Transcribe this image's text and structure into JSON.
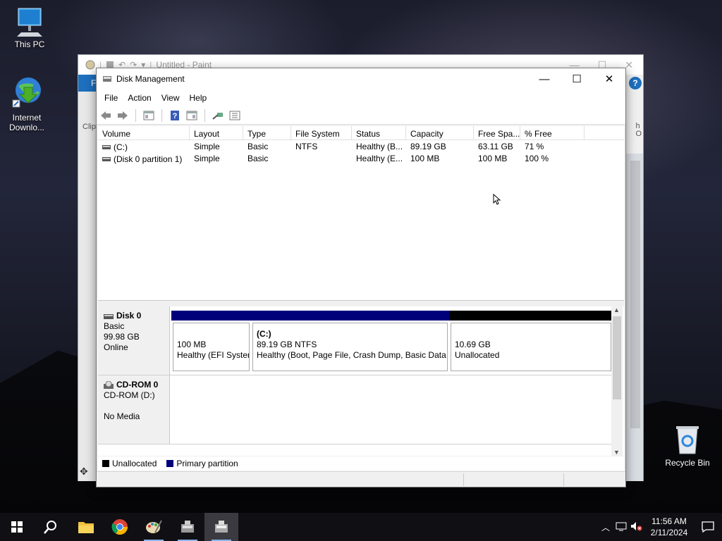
{
  "desktop": {
    "icons": [
      {
        "label": "This PC"
      },
      {
        "label": "Internet Downlo..."
      },
      {
        "label": "Recycle Bin"
      }
    ]
  },
  "paint": {
    "title": "Untitled - Paint",
    "ribbon_tab": "F",
    "clip_fragment": "Clip",
    "right_fragment": "h\nO"
  },
  "window": {
    "title": "Disk Management",
    "minimize": "—",
    "maximize": "☐",
    "close": "✕"
  },
  "menu": [
    "File",
    "Action",
    "View",
    "Help"
  ],
  "toolbar_icons": [
    "back-arrow-icon",
    "forward-arrow-icon",
    "properties-icon",
    "help-icon",
    "console-icon",
    "rescan-icon",
    "list-icon"
  ],
  "volumes": {
    "columns": [
      "Volume",
      "Layout",
      "Type",
      "File System",
      "Status",
      "Capacity",
      "Free Spa...",
      "% Free"
    ],
    "rows": [
      [
        "(C:)",
        "Simple",
        "Basic",
        "NTFS",
        "Healthy (B...",
        "89.19 GB",
        "63.11 GB",
        "71 %"
      ],
      [
        "(Disk 0 partition 1)",
        "Simple",
        "Basic",
        "",
        "Healthy (E...",
        "100 MB",
        "100 MB",
        "100 %"
      ]
    ]
  },
  "disks": [
    {
      "name": "Disk 0",
      "type": "Basic",
      "size": "99.98 GB",
      "state": "Online",
      "partitions": [
        {
          "label": "",
          "size": "100 MB",
          "status": "Healthy (EFI System Partition)",
          "kind": "primary"
        },
        {
          "label": "(C:)",
          "size": "89.19 GB NTFS",
          "status": "Healthy (Boot, Page File, Crash Dump, Basic Data Partition)",
          "kind": "primary"
        },
        {
          "label": "",
          "size": "10.69 GB",
          "status": "Unallocated",
          "kind": "unallocated"
        }
      ]
    },
    {
      "name": "CD-ROM 0",
      "type": "CD-ROM (D:)",
      "size": "",
      "state": "No Media"
    }
  ],
  "legend": [
    {
      "label": "Unallocated",
      "color": "#000000"
    },
    {
      "label": "Primary partition",
      "color": "#00007b"
    }
  ],
  "colors": {
    "primary": "#00007b",
    "unallocated": "#000000"
  },
  "taskbar": {
    "items": [
      "start-icon",
      "search-icon",
      "file-explorer-icon",
      "chrome-icon",
      "paint-icon",
      "disk-management-icon",
      "disk-management-active-icon"
    ],
    "time": "11:56 AM",
    "date": "2/11/2024"
  }
}
